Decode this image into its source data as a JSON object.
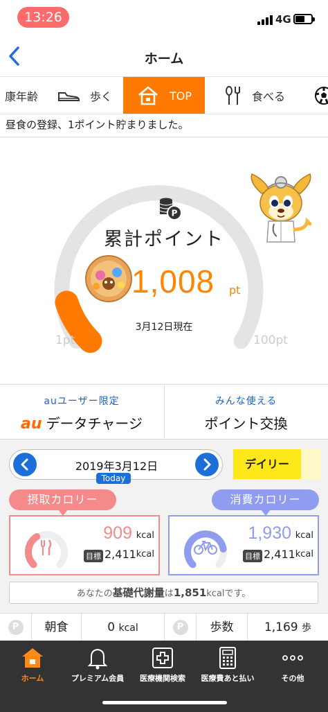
{
  "status": {
    "time": "13:26",
    "network": "4G"
  },
  "nav": {
    "title": "ホーム"
  },
  "tabs": [
    {
      "label": "康年齢"
    },
    {
      "label": "歩く"
    },
    {
      "label": "TOP"
    },
    {
      "label": "食べる"
    }
  ],
  "notice": "昼食の登録、1ポイント貯まりました。",
  "points": {
    "label": "累計ポイント",
    "value": "1,008",
    "unit": "pt",
    "as_of": "3月12日現在",
    "min_label": "1pt",
    "max_label": "100pt",
    "progress_fraction": 0.1
  },
  "promo": {
    "left_sub": "auユーザー限定",
    "left_brand": "au",
    "left_main": "データチャージ",
    "right_sub": "みんな使える",
    "right_main": "ポイント交換"
  },
  "date": {
    "text": "2019年3月12日",
    "today": "Today",
    "period_button": "デイリー"
  },
  "intake": {
    "label": "摂取カロリー",
    "value": "909",
    "unit": "kcal",
    "goal_tag": "目標",
    "goal": "2,411",
    "goal_unit": "kcal",
    "progress_fraction": 0.38,
    "color": "#f48a8a"
  },
  "burn": {
    "label": "消費カロリー",
    "value": "1,930",
    "unit": "kcal",
    "goal_tag": "目標",
    "goal": "2,411",
    "goal_unit": "kcal",
    "progress_fraction": 0.8,
    "color": "#8f9cf0"
  },
  "bmr": {
    "prefix": "あなたの",
    "term": "基礎代謝量",
    "mid": "は",
    "value": "1,851",
    "unit": "kcal",
    "suffix": "です。"
  },
  "meals": {
    "p_chip": "P",
    "breakfast_label": "朝食",
    "breakfast_value": "0",
    "breakfast_unit": "kcal",
    "steps_label": "歩数",
    "steps_value": "1,169",
    "steps_unit": "歩"
  },
  "tabbar": [
    {
      "label": "ホーム",
      "icon": "home-icon"
    },
    {
      "label": "プレミアム会員",
      "icon": "bell-icon"
    },
    {
      "label": "医療機関検索",
      "icon": "medical-cross-icon"
    },
    {
      "label": "医療費あと払い",
      "icon": "calculator-icon"
    },
    {
      "label": "その他",
      "icon": "more-dots-icon"
    }
  ]
}
